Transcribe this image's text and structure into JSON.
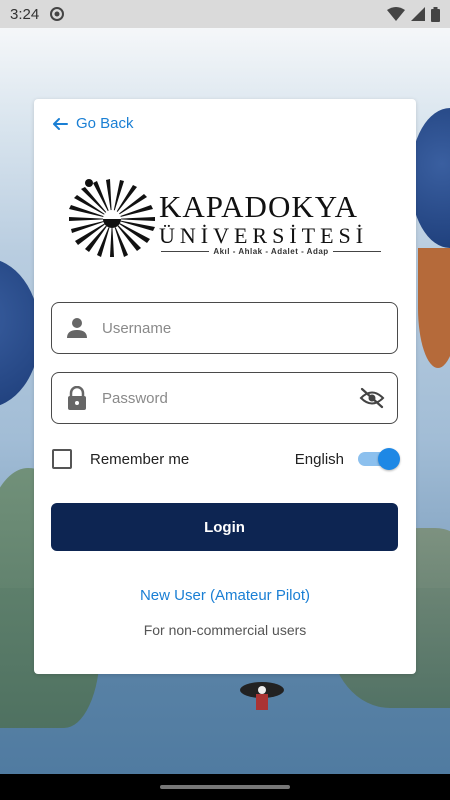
{
  "status_bar": {
    "time": "3:24"
  },
  "card": {
    "go_back": "Go Back",
    "logo": {
      "line1": "KAPADOKYA",
      "line2": "ÜNİVERSİTESİ",
      "tagline": "Akıl - Ahlak - Adalet - Adap"
    },
    "username": {
      "placeholder": "Username",
      "value": ""
    },
    "password": {
      "placeholder": "Password",
      "value": ""
    },
    "remember_label": "Remember me",
    "remember_checked": false,
    "language_label": "English",
    "language_toggle_on": true,
    "login_label": "Login",
    "new_user_link": "New User (Amateur Pilot)",
    "new_user_note": "For non-commercial users"
  },
  "colors": {
    "accent": "#1a7fd4",
    "login_button": "#0d2552",
    "toggle": "#1e88e5"
  }
}
